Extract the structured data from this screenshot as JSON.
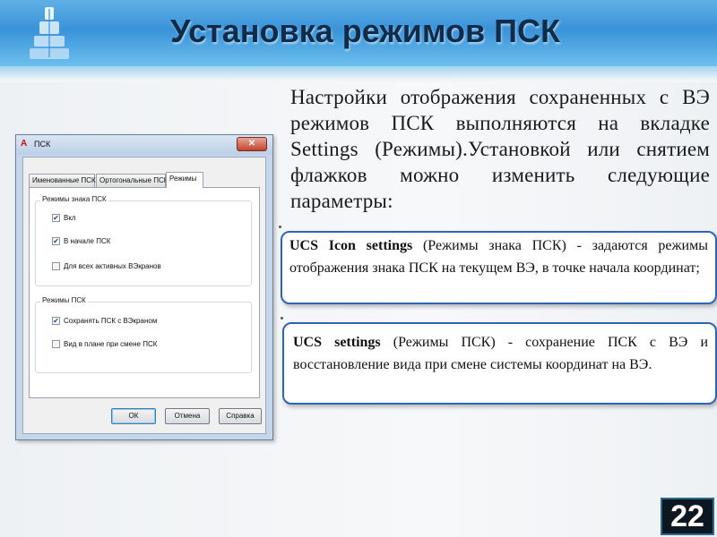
{
  "header": {
    "title": "Установка режимов ПСК"
  },
  "intro_text": "Настройки отображения сохраненных с ВЭ режимов ПСК выполняются на вкладке Settings (Режимы).Установкой или снятием флажков можно изменить следующие параметры:",
  "callouts": [
    {
      "term": "UCS Icon settings",
      "text": " (Режимы знака ПСК) - задаются режимы отображения знака ПСК на текущем ВЭ, в точке начала координат;"
    },
    {
      "term": "UCS settings",
      "text": " (Режимы ПСК) - сохранение ПСК с ВЭ и восстановление вида при смене системы координат на ВЭ."
    }
  ],
  "dialog": {
    "title": "ПСК",
    "close_label": "✕",
    "tabs": [
      {
        "label": "Именованные ПСК",
        "active": false
      },
      {
        "label": "Ортогональные ПСК",
        "active": false
      },
      {
        "label": "Режимы",
        "active": true
      }
    ],
    "groups": [
      {
        "label": "Режимы знака ПСК",
        "options": [
          {
            "label": "Вкл",
            "checked": true,
            "mark": "✔"
          },
          {
            "label": "В начале ПСК",
            "checked": true,
            "mark": "✔"
          },
          {
            "label": "Для всех активных ВЭкранов",
            "checked": false,
            "mark": ""
          }
        ]
      },
      {
        "label": "Режимы ПСК",
        "options": [
          {
            "label": "Сохранять ПСК с ВЭкраном",
            "checked": true,
            "mark": "✔"
          },
          {
            "label": "Вид в плане при смене ПСК",
            "checked": false,
            "mark": ""
          }
        ]
      }
    ],
    "buttons": {
      "ok": "ОК",
      "cancel": "Отмена",
      "help": "Справка"
    }
  },
  "page_number": "22",
  "colors": {
    "header": "#3a93d8",
    "callout_border": "#2d66b8",
    "title_text": "#0f2c4a"
  }
}
